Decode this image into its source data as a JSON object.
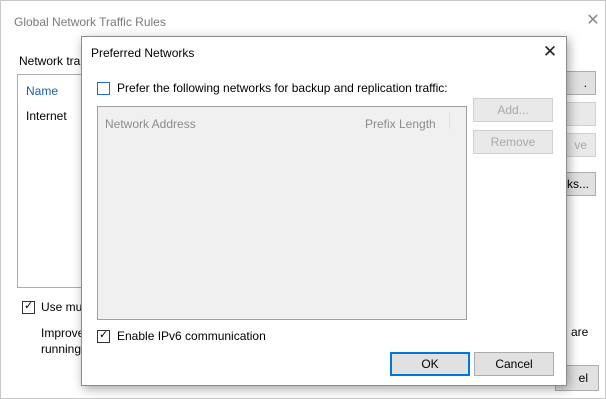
{
  "parent": {
    "title": "Global Network Traffic Rules",
    "close_symbol": "✕",
    "group_label": "Network tra",
    "list_header": "Name",
    "list_row": "Internet",
    "btn1_label": ".",
    "btn2_label": "",
    "btn3_label": "ve",
    "btn4_label": "ks...",
    "use_checkbox_label": "Use mu",
    "desc_line1": "Improve",
    "desc_line2": "running",
    "desc_suffix": "are",
    "cancel_partial": "el"
  },
  "modal": {
    "title": "Preferred Networks",
    "close_symbol": "✕",
    "prefer_label": "Prefer the following networks for backup and replication traffic:",
    "prefer_checked": false,
    "columns": [
      "Network Address",
      "Prefix Length"
    ],
    "add_label": "Add...",
    "remove_label": "Remove",
    "ipv6_label": "Enable IPv6 communication",
    "ipv6_checked": true,
    "ok_label": "OK",
    "cancel_label": "Cancel"
  }
}
